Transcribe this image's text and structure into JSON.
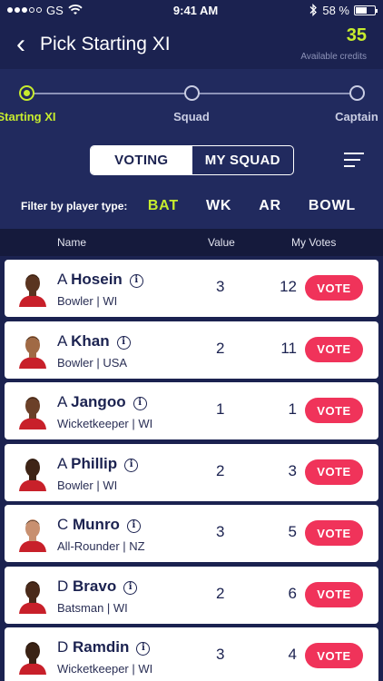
{
  "status": {
    "carrier": "GS",
    "time": "9:41 AM",
    "battery": "58 %",
    "battery_level": 0.58
  },
  "header": {
    "title": "Pick Starting XI",
    "credits_value": "35",
    "credits_label": "Available credits"
  },
  "stepper": {
    "steps": [
      {
        "label": "Starting XI",
        "active": true
      },
      {
        "label": "Squad",
        "active": false
      },
      {
        "label": "Captain",
        "active": false
      }
    ]
  },
  "toggle": {
    "voting": "VOTING",
    "my_squad": "MY SQUAD"
  },
  "filters": {
    "label": "Filter by player type:",
    "items": [
      "BAT",
      "WK",
      "AR",
      "BOWL"
    ],
    "selected": "BAT"
  },
  "table": {
    "headers": {
      "name": "Name",
      "value": "Value",
      "votes": "My Votes"
    }
  },
  "players": [
    {
      "initial": "A",
      "last": "Hosein",
      "meta": "Bowler | WI",
      "value": "3",
      "votes": "12",
      "vote_label": "VOTE",
      "skin": "#5a3420"
    },
    {
      "initial": "A",
      "last": "Khan",
      "meta": "Bowler | USA",
      "value": "2",
      "votes": "11",
      "vote_label": "VOTE",
      "skin": "#a06a45"
    },
    {
      "initial": "A",
      "last": "Jangoo",
      "meta": "Wicketkeeper | WI",
      "value": "1",
      "votes": "1",
      "vote_label": "VOTE",
      "skin": "#6b4028"
    },
    {
      "initial": "A",
      "last": "Phillip",
      "meta": "Bowler | WI",
      "value": "2",
      "votes": "3",
      "vote_label": "VOTE",
      "skin": "#3e2416"
    },
    {
      "initial": "C",
      "last": "Munro",
      "meta": "All-Rounder | NZ",
      "value": "3",
      "votes": "5",
      "vote_label": "VOTE",
      "skin": "#c89070"
    },
    {
      "initial": "D",
      "last": "Bravo",
      "meta": "Batsman | WI",
      "value": "2",
      "votes": "6",
      "vote_label": "VOTE",
      "skin": "#4a2a1a"
    },
    {
      "initial": "D",
      "last": "Ramdin",
      "meta": "Wicketkeeper | WI",
      "value": "3",
      "votes": "4",
      "vote_label": "VOTE",
      "skin": "#3a2214"
    }
  ],
  "colors": {
    "accent": "#c7ec2e",
    "vote": "#f0335a",
    "background": "#1b2250",
    "jersey": "#c8202a"
  }
}
